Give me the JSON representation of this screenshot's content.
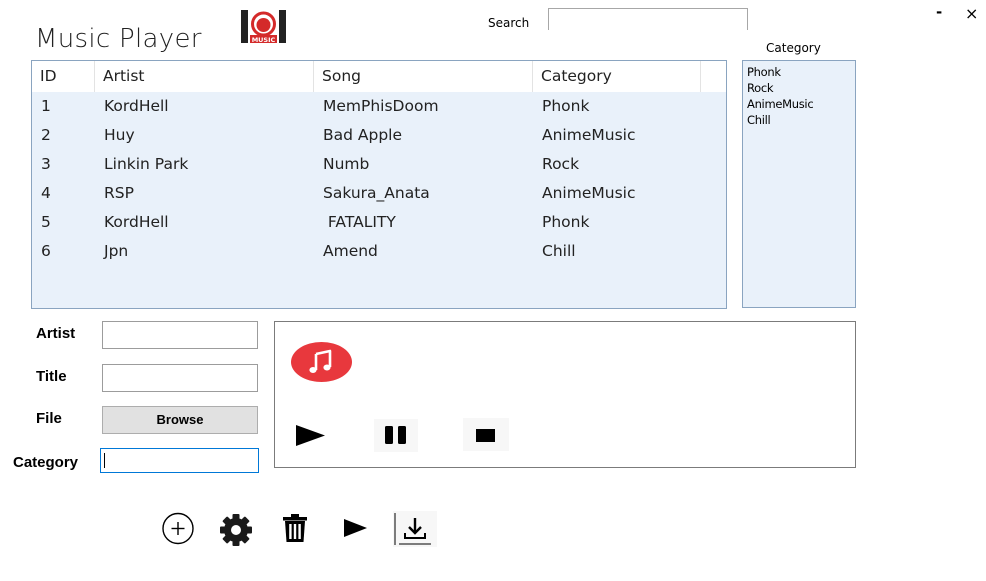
{
  "app": {
    "title": "Music Player",
    "logo_text": "MUSIC"
  },
  "window": {
    "minimize": "-",
    "close": "×"
  },
  "search": {
    "label": "Search",
    "value": ""
  },
  "table": {
    "columns": [
      "ID",
      "Artist",
      "Song",
      "Category"
    ],
    "rows": [
      [
        "1",
        "KordHell",
        "MemPhisDoom",
        "Phonk"
      ],
      [
        "2",
        "Huy",
        "Bad Apple",
        "AnimeMusic"
      ],
      [
        "3",
        "Linkin Park",
        "Numb",
        "Rock"
      ],
      [
        "4",
        "RSP",
        "Sakura_Anata",
        "AnimeMusic"
      ],
      [
        "5",
        "KordHell",
        " FATALITY",
        "Phonk"
      ],
      [
        "6",
        "Jpn",
        "Amend",
        "Chill"
      ]
    ]
  },
  "category_panel": {
    "label": "Category",
    "items": [
      "Phonk",
      "Rock",
      "AnimeMusic",
      "Chill"
    ]
  },
  "form": {
    "artist_label": "Artist",
    "artist_value": "",
    "title_label": "Title",
    "title_value": "",
    "file_label": "File",
    "browse_label": "Browse",
    "category_label": "Category",
    "category_value": ""
  },
  "player": {
    "badge_icon": "music-note-icon",
    "controls": [
      "play-icon",
      "pause-icon",
      "stop-icon"
    ]
  },
  "toolbar": {
    "icons": [
      "add-circle-icon",
      "gear-icon",
      "trash-icon",
      "play-icon",
      "download-icon"
    ]
  },
  "colors": {
    "badge_red": "#e8383d",
    "list_background": "#e9f1fa",
    "focus_blue": "#0078d7"
  }
}
